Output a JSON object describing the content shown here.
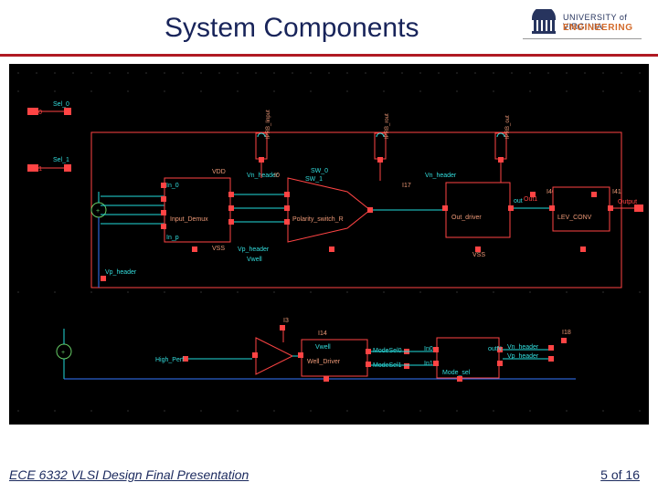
{
  "header": {
    "title": "System Components",
    "logo": {
      "line1": "UNIVERSITY of VIRGINIA",
      "line2": "ENGINEERING"
    }
  },
  "signals": {
    "sel0_port": "Sel0",
    "sel0_label": "Sel_0",
    "sel1_port": "Sel1",
    "sel1_label": "Sel_1",
    "out1": "Out1",
    "output": "Output",
    "vn_header1": "Vn_header",
    "vp_header": "Vp_header",
    "vwell": "Vwell",
    "vn_header2": "Vn_header",
    "vp_header2": "Vp_header",
    "high_perf": "High_Perf",
    "mode_sel0": "ModeSel0",
    "mode_sel1": "ModeSel1",
    "in0": "In0",
    "in1": "In1",
    "mode_sel": "Mode_sel",
    "outn": "outN"
  },
  "pins": {
    "in_d": "In_0",
    "sw_b": "SW_0",
    "vss": "VSS",
    "in_p": "In_p",
    "vdd": "VDD",
    "i0": "I0",
    "i17": "I17",
    "i14": "I14",
    "i40": "I40",
    "i41": "I41",
    "i3": "I3",
    "i18": "I18",
    "out": "out"
  },
  "blocks": {
    "input_demux": "Input_Demux",
    "polarity_switch": "Polarity_switch_R",
    "out_driver": "Out_driver",
    "lev_conv": "LEV_CONV",
    "well_driver": "Well_Driver",
    "iprb_lin": "IPRB_linput",
    "iprb_rout": "IPRB_rout",
    "iprb_out": "IPRB_out"
  },
  "footer": {
    "left": "ECE 6332 VLSI Design Final Presentation",
    "right": "5 of  16"
  }
}
